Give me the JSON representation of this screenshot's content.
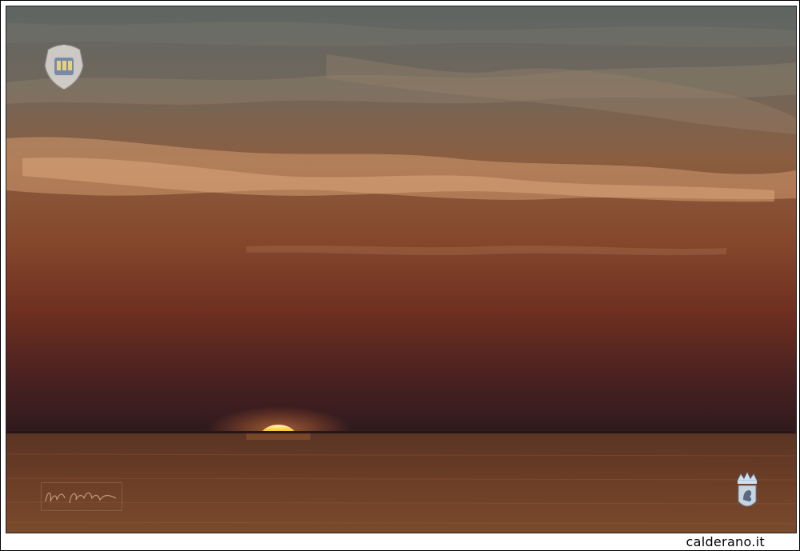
{
  "footer": {
    "site_label": "calderano.it"
  },
  "colors": {
    "sky_top": "#6c6a60",
    "sky_mid": "#8a5a3c",
    "sky_low": "#7a3a26",
    "horizon": "#3a1c1a",
    "sea": "#6a3c26",
    "sun": "#ffd23a",
    "sun_core": "#fff6b0"
  },
  "watermarks": {
    "top_left": "crest-emblem",
    "bottom_left": "signature",
    "bottom_right": "crowned-lion-crest"
  }
}
